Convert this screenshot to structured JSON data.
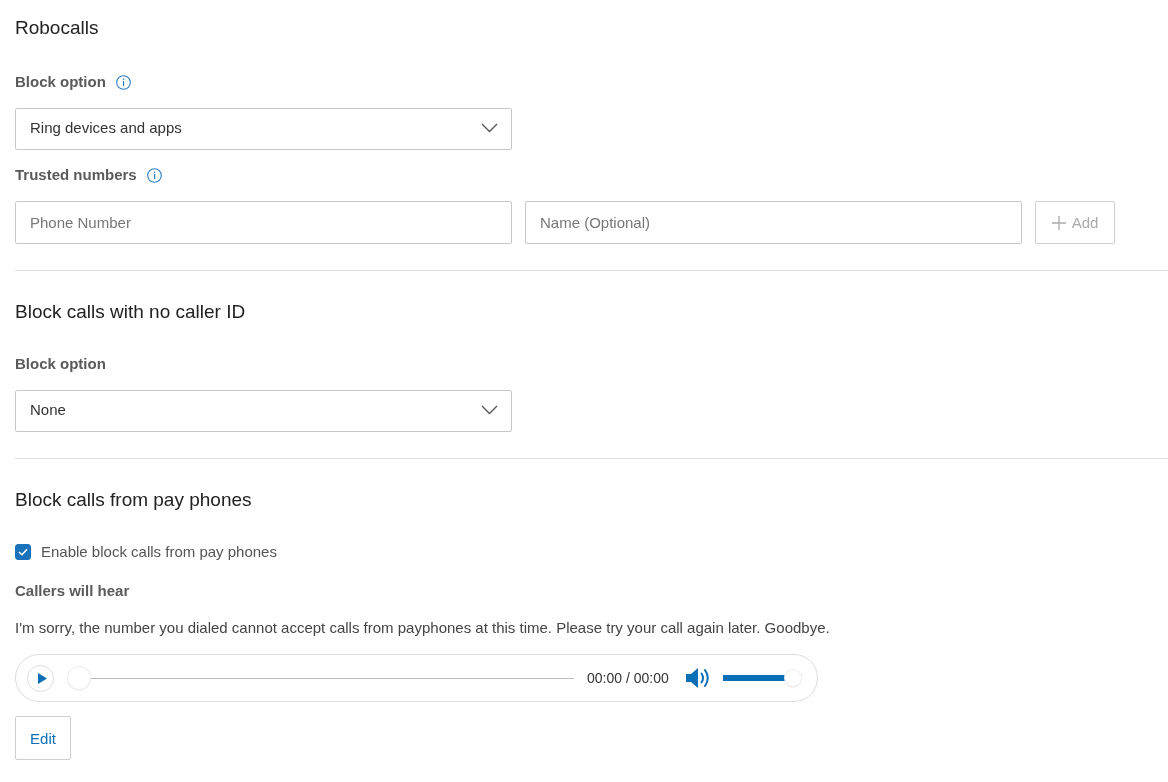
{
  "sections": [
    {
      "title": "Robocalls",
      "fields": [
        {
          "kind": "select",
          "label": "Block option",
          "info": true,
          "value": "Ring devices and apps"
        },
        {
          "kind": "inputs",
          "label": "Trusted numbers",
          "info": true,
          "inputs": [
            {
              "placeholder": "Phone Number"
            },
            {
              "placeholder": "Name (Optional)"
            }
          ],
          "button": {
            "label": "Add",
            "disabled": true
          }
        }
      ]
    },
    {
      "title": "Block calls with no caller ID",
      "fields": [
        {
          "kind": "select",
          "label": "Block option",
          "value": "None"
        }
      ]
    },
    {
      "title": "Block calls from pay phones",
      "fields": [
        {
          "kind": "checkbox",
          "label": "Enable block calls from pay phones",
          "checked": true
        },
        {
          "kind": "message",
          "label": "Callers will hear",
          "text": "I'm sorry, the number you dialed cannot accept calls from payphones at this time. Please try your call again later. Goodbye."
        },
        {
          "kind": "player",
          "time": "00:00 / 00:00",
          "seek": {
            "level": 0
          },
          "volume": {
            "level": 1
          }
        },
        {
          "kind": "button",
          "label": "Edit"
        }
      ]
    }
  ]
}
